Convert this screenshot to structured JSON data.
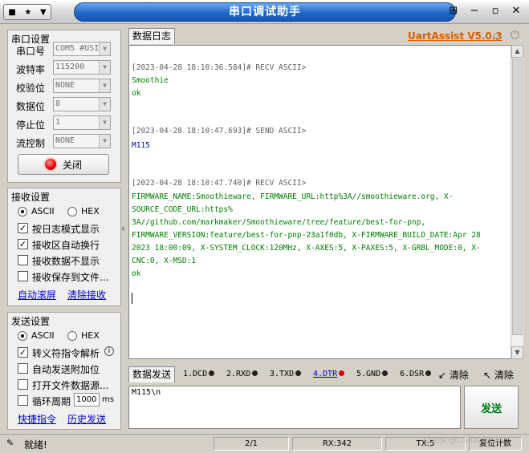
{
  "window": {
    "title": "串口调试助手"
  },
  "serial": {
    "group_title": "串口设置",
    "port_label": "串口号",
    "port_value": "COM5 #USI",
    "baud_label": "波特率",
    "baud_value": "115200",
    "parity_label": "校验位",
    "parity_value": "NONE",
    "databits_label": "数据位",
    "databits_value": "8",
    "stopbits_label": "停止位",
    "stopbits_value": "1",
    "flow_label": "流控制",
    "flow_value": "NONE",
    "close_label": "关闭"
  },
  "receive": {
    "group_title": "接收设置",
    "ascii_label": "ASCII",
    "hex_label": "HEX",
    "opt_log_mode": "按日志模式显示",
    "opt_autowrap": "接收区自动换行",
    "opt_hide": "接收数据不显示",
    "opt_save": "接收保存到文件...",
    "link_autoscroll": "自动滚屏",
    "link_clear": "清除接收"
  },
  "send": {
    "group_title": "发送设置",
    "ascii_label": "ASCII",
    "hex_label": "HEX",
    "opt_escape": "转义符指令解析",
    "opt_append": "自动发送附加位",
    "opt_file": "打开文件数据源...",
    "opt_cycle": "循环周期",
    "cycle_value": "1000",
    "cycle_unit": "ms",
    "link_shortcut": "快捷指令",
    "link_history": "历史发送"
  },
  "log": {
    "tab_label": "数据日志",
    "brand": "UartAssist V5.0.3",
    "lines": [
      {
        "text": "[2023-04-28 18:10:36.584]# RECV ASCII>",
        "color": "#606060"
      },
      {
        "text": "Smoothie",
        "color": "#008000"
      },
      {
        "text": "ok",
        "color": "#008000"
      },
      {
        "text": "[2023-04-28 18:10:47.693]# SEND ASCII>",
        "color": "#606060"
      },
      {
        "text": "M115",
        "color": "#0000c0"
      },
      {
        "text": "[2023-04-28 18:10:47.740]# RECV ASCII>",
        "color": "#606060"
      },
      {
        "text": "FIRMWARE_NAME:Smoothieware, FIRMWARE_URL:http%3A//smoothieware.org, X-",
        "color": "#008000"
      },
      {
        "text": "SOURCE_CODE_URL:https%",
        "color": "#008000"
      },
      {
        "text": "3A//github.com/markmaker/Smoothieware/tree/feature/best-for-pnp,",
        "color": "#008000"
      },
      {
        "text": "FIRMWARE_VERSION:feature/best-for-pnp-23a1f0db, X-FIRMWARE_BUILD_DATE:Apr 28",
        "color": "#008000"
      },
      {
        "text": "2023 18:00:09, X-SYSTEM_CLOCK:120MHz, X-AXES:5, X-PAXES:5, X-GRBL_MODE:0, X-",
        "color": "#008000"
      },
      {
        "text": "CNC:0, X-MSD:1",
        "color": "#008000"
      },
      {
        "text": "ok",
        "color": "#008000"
      }
    ]
  },
  "sendarea": {
    "tab_label": "数据发送",
    "pins": [
      "1.DCD",
      "2.RXD",
      "3.TXD",
      "4.DTR",
      "5.GND",
      "6.DSR"
    ],
    "clear1": "清除",
    "clear2": "清除",
    "input_value": "M115\\n",
    "send_label": "发送"
  },
  "status": {
    "ready": "就绪!",
    "pages": "2/1",
    "rx": "RX:342",
    "tx": "TX:5",
    "reset": "复位计数",
    "watermark": "CSDN @Lolita_d"
  }
}
